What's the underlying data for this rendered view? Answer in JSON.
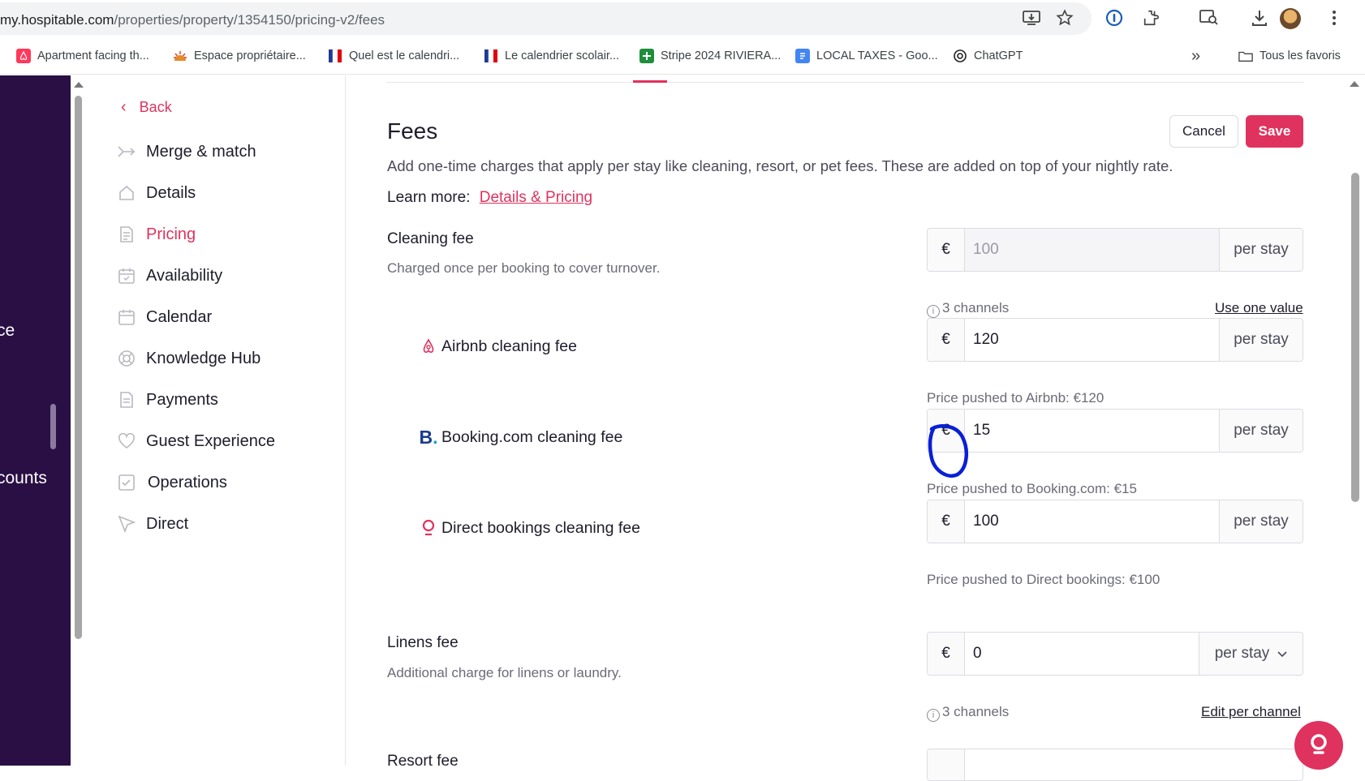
{
  "browser": {
    "url_host": "my.hospitable.com",
    "url_path": "/properties/property/1354150/pricing-v2/fees",
    "bookmarks": [
      {
        "label": "Apartment facing th...",
        "icon": "airbnb-icon",
        "color": "#ff385c"
      },
      {
        "label": "Espace propriétaire...",
        "icon": "sun-logo-icon",
        "color": "#e88a2a"
      },
      {
        "label": "Quel est le calendri...",
        "icon": "french-flag-icon",
        "color": "#1f3a93"
      },
      {
        "label": "Le calendrier scolair...",
        "icon": "french-flag-icon",
        "color": "#1f3a93"
      },
      {
        "label": "Stripe 2024 RIVIERA...",
        "icon": "sheets-icon",
        "color": "#1e8e3e"
      },
      {
        "label": "LOCAL TAXES - Goo...",
        "icon": "docs-icon",
        "color": "#4285f4"
      },
      {
        "label": "ChatGPT",
        "icon": "chatgpt-icon",
        "color": "#202124"
      }
    ],
    "all_bookmarks_label": "Tous les favoris"
  },
  "rail": {
    "fragment_1": "ce",
    "fragment_2": "counts"
  },
  "sidebar": {
    "back_label": "Back",
    "items": [
      {
        "label": "Merge & match",
        "icon": "merge-icon",
        "active": false
      },
      {
        "label": "Details",
        "icon": "home-icon",
        "active": false
      },
      {
        "label": "Pricing",
        "icon": "document-icon",
        "active": true
      },
      {
        "label": "Availability",
        "icon": "calendar-check-icon",
        "active": false
      },
      {
        "label": "Calendar",
        "icon": "calendar-icon",
        "active": false
      },
      {
        "label": "Knowledge Hub",
        "icon": "lifebuoy-icon",
        "active": false
      },
      {
        "label": "Payments",
        "icon": "receipt-icon",
        "active": false
      },
      {
        "label": "Guest Experience",
        "icon": "heart-icon",
        "active": false
      },
      {
        "label": "Operations",
        "icon": "checkbox-icon",
        "active": false
      },
      {
        "label": "Direct",
        "icon": "cursor-icon",
        "active": false
      }
    ]
  },
  "main": {
    "title": "Fees",
    "cancel_label": "Cancel",
    "save_label": "Save",
    "description": "Add one-time charges that apply per stay like cleaning, resort, or pet fees. These are added on top of your nightly rate.",
    "learn_more_label": "Learn more:",
    "learn_more_link": "Details & Pricing",
    "cleaning": {
      "title": "Cleaning fee",
      "subtitle": "Charged once per booking to cover turnover.",
      "currency": "€",
      "value": "100",
      "unit": "per stay",
      "channels_info": "3 channels",
      "use_one_value": "Use one value",
      "channels": [
        {
          "label": "Airbnb cleaning fee",
          "icon": "airbnb-icon",
          "value": "120",
          "currency": "€",
          "unit": "per stay",
          "pushed": "Price pushed to Airbnb: €120"
        },
        {
          "label": "Booking.com cleaning fee",
          "icon": "booking-icon",
          "value": "15",
          "currency": "€",
          "unit": "per stay",
          "pushed": "Price pushed to Booking.com: €15"
        },
        {
          "label": "Direct bookings cleaning fee",
          "icon": "direct-pin-icon",
          "value": "100",
          "currency": "€",
          "unit": "per stay",
          "pushed": "Price pushed to Direct bookings: €100"
        }
      ]
    },
    "linens": {
      "title": "Linens fee",
      "subtitle": "Additional charge for linens or laundry.",
      "currency": "€",
      "value": "0",
      "unit": "per stay",
      "channels_info": "3 channels",
      "edit_per_channel": "Edit per channel"
    },
    "resort": {
      "title": "Resort fee"
    }
  },
  "colors": {
    "accent": "#e0325e",
    "rail": "#2a0f45",
    "annotation": "#0a1fd6"
  }
}
